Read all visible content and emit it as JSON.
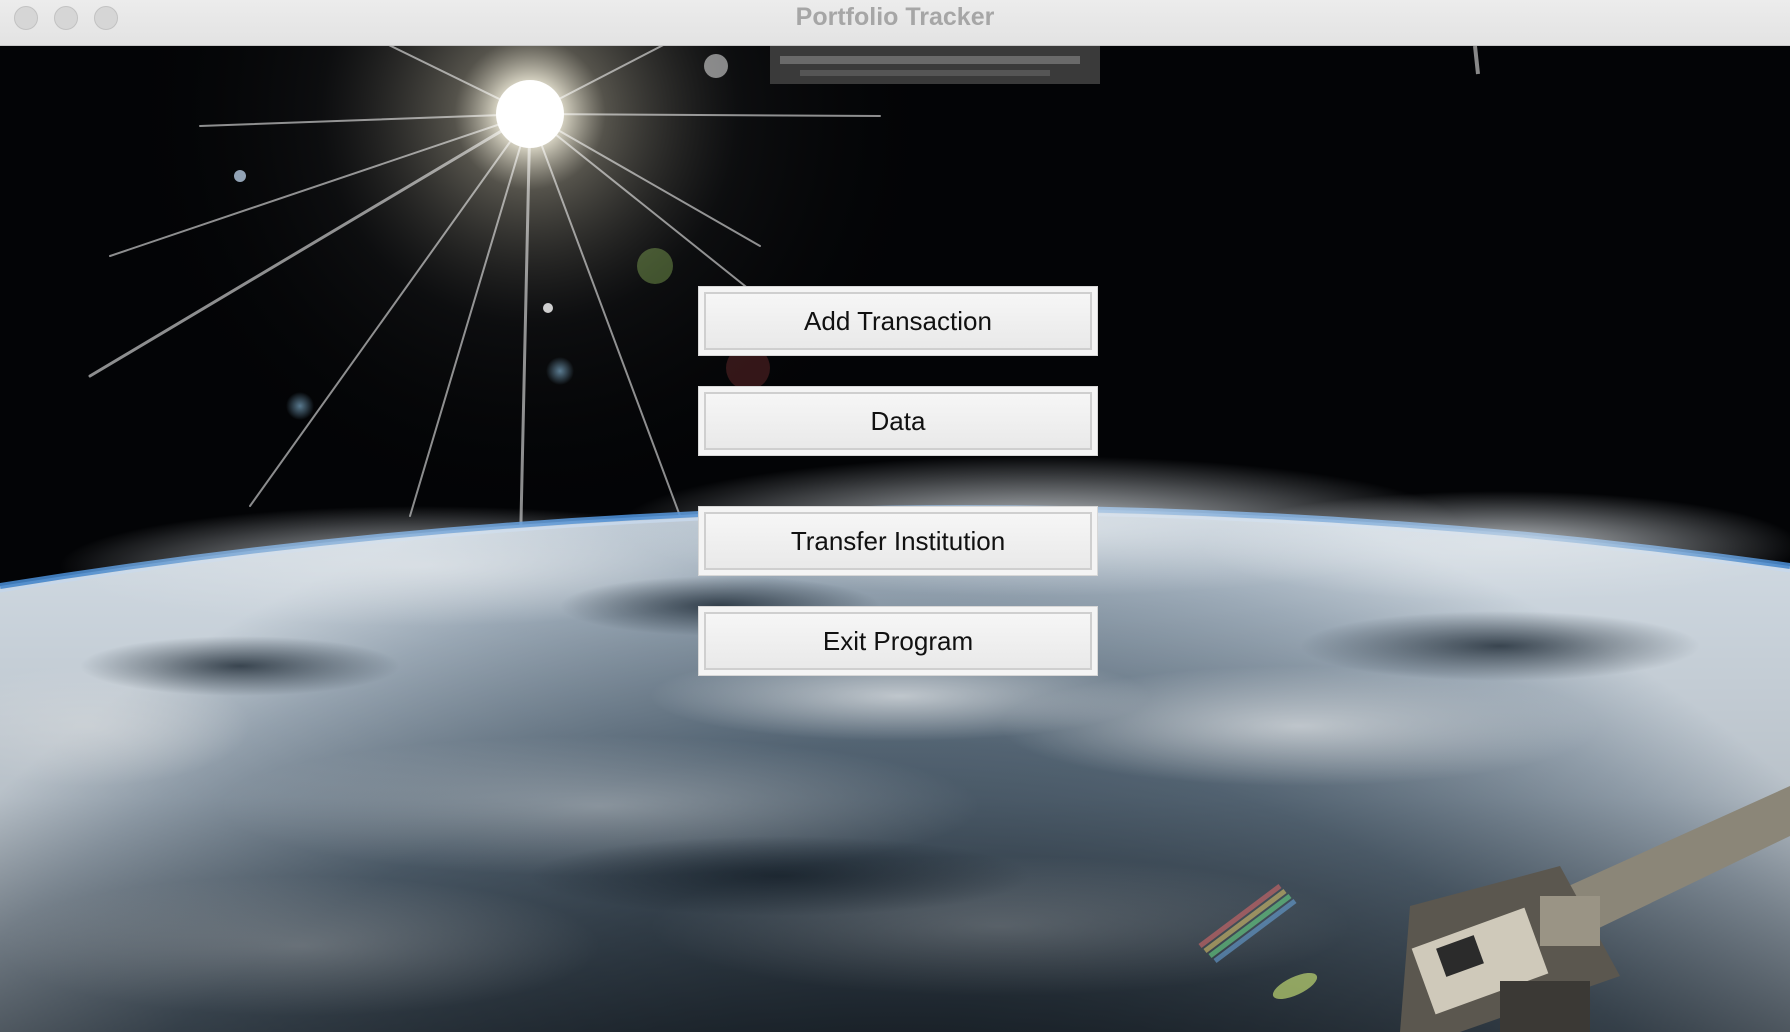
{
  "window": {
    "title": "Portfolio Tracker"
  },
  "menu": {
    "add_transaction": "Add Transaction",
    "data": "Data",
    "transfer_institution": "Transfer Institution",
    "exit_program": "Exit Program"
  },
  "colors": {
    "titlebar": "#e8e8e8",
    "title_text": "#a6a6a6",
    "button_face": "#f0f0f0",
    "button_border": "#cfcfcf",
    "space": "#030406",
    "earth_atmosphere": "#4a8fd8"
  }
}
